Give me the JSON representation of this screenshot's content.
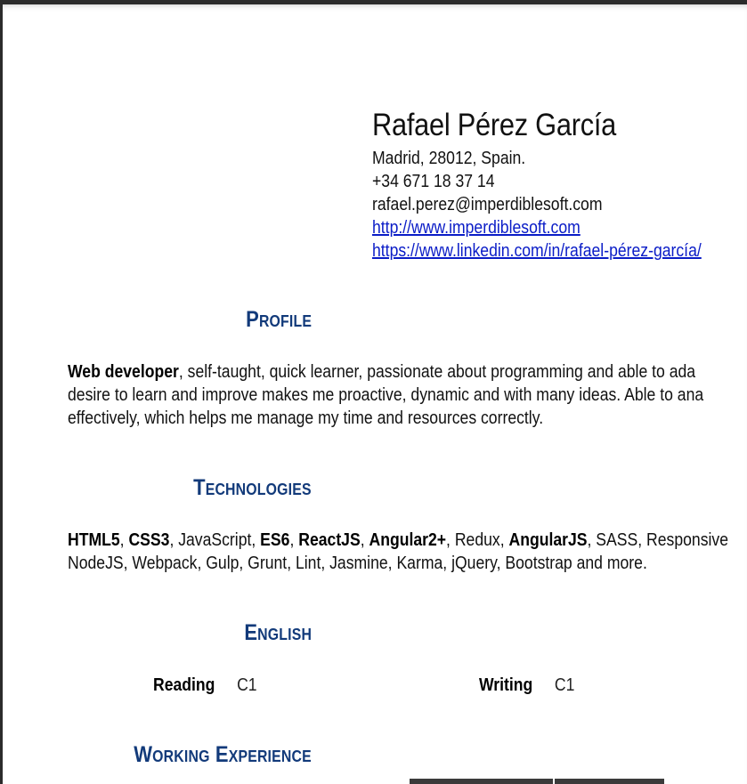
{
  "contact": {
    "name": "Rafael Pérez García",
    "address": "Madrid, 28012, Spain.",
    "phone": "+34 671 18 37 14",
    "email": "rafael.perez@imperdiblesoft.com",
    "website": "http://www.imperdiblesoft.com",
    "linkedin": "https://www.linkedin.com/in/rafael-pérez-garcía/"
  },
  "sections": {
    "profile": {
      "title": "Profile",
      "lead": "Web developer",
      "text_line1": ", self-taught, quick learner, passionate about programming and able to ada",
      "text_line2": "desire to learn and improve makes me proactive, dynamic and with many ideas. Able to ana",
      "text_line3": "effectively, which helps me manage my time and resources correctly."
    },
    "technologies": {
      "title": "Technologies",
      "items": [
        {
          "text": "HTML5",
          "bold": true
        },
        {
          "text": ", ",
          "bold": false
        },
        {
          "text": "CSS3",
          "bold": true
        },
        {
          "text": ", JavaScript, ",
          "bold": false
        },
        {
          "text": "ES6",
          "bold": true
        },
        {
          "text": ", ",
          "bold": false
        },
        {
          "text": "ReactJS",
          "bold": true
        },
        {
          "text": ", ",
          "bold": false
        },
        {
          "text": "Angular2+",
          "bold": true
        },
        {
          "text": ", Redux, ",
          "bold": false
        },
        {
          "text": "AngularJS",
          "bold": true
        },
        {
          "text": ", SASS, Responsive",
          "bold": false
        }
      ],
      "line2": "NodeJS, Webpack, Gulp, Grunt, Lint, Jasmine, Karma, jQuery, Bootstrap and more."
    },
    "english": {
      "title": "English",
      "reading_label": "Reading",
      "reading_level": "C1",
      "writing_label": "Writing",
      "writing_level": "C1"
    },
    "experience": {
      "title": "Working Experience"
    }
  },
  "colors": {
    "heading": "#123a7a",
    "link": "#0a1cc7"
  }
}
